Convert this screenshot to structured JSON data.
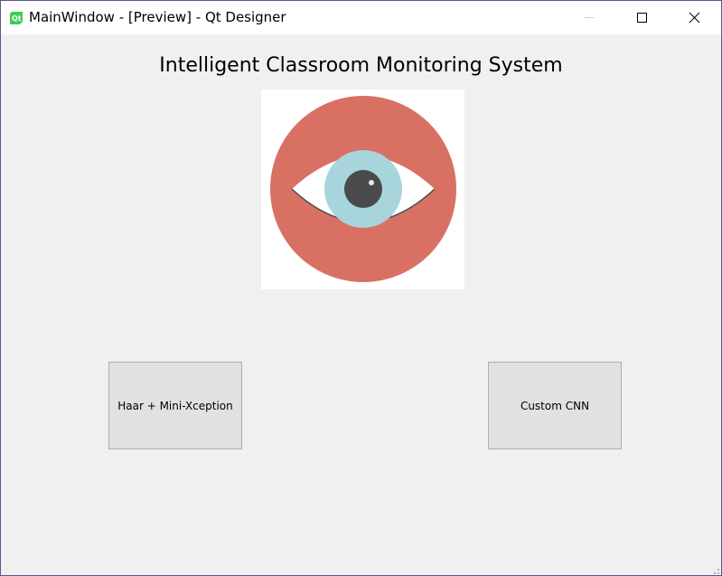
{
  "window": {
    "title": "MainWindow - [Preview] - Qt Designer",
    "app_icon": "qt-designer-icon",
    "controls": {
      "minimize_icon": "minimize-icon",
      "maximize_icon": "maximize-icon",
      "close_icon": "close-icon"
    }
  },
  "main": {
    "heading": "Intelligent Classroom Monitoring System",
    "logo_icon": "eye-icon",
    "buttons": [
      {
        "label": "Haar + Mini-Xception"
      },
      {
        "label": "Custom CNN"
      }
    ]
  },
  "colors": {
    "window_bg": "#f0f0f0",
    "button_bg": "#e1e1e1",
    "button_border": "#adadad",
    "eye_ring": "#d97064",
    "eye_iris": "#a7d5db",
    "eye_pupil": "#4a4a4c",
    "qt_green": "#41cd52"
  }
}
